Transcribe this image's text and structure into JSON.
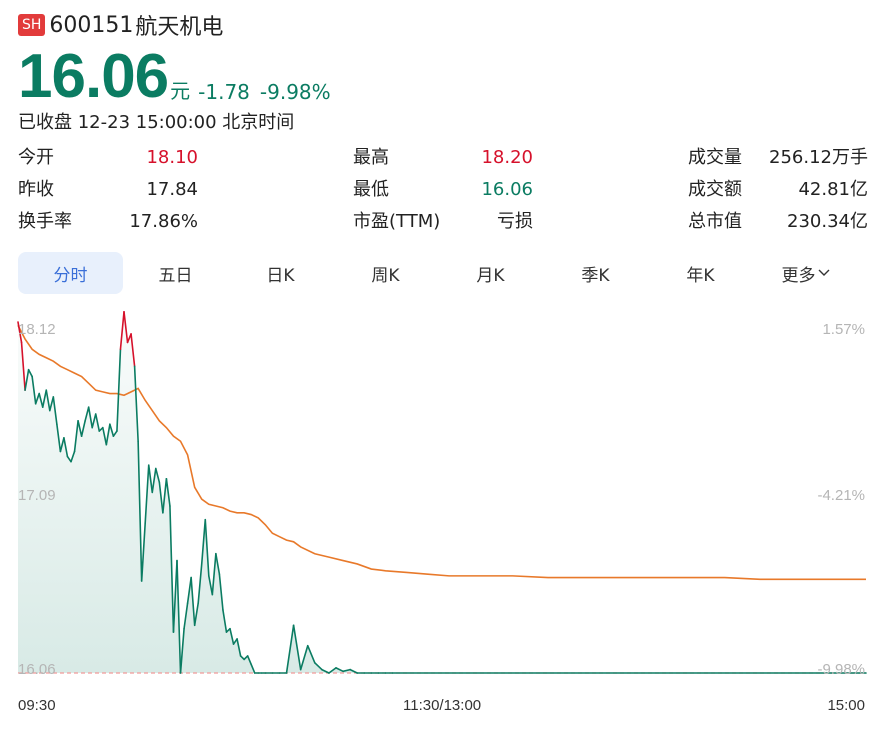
{
  "header": {
    "market_badge": "SH",
    "code": "600151",
    "name": "航天机电"
  },
  "quote": {
    "price": "16.06",
    "unit": "元",
    "change": "-1.78",
    "change_pct": "-9.98%",
    "status": "已收盘 12-23 15:00:00 北京时间"
  },
  "stats": {
    "open": {
      "label": "今开",
      "value": "18.10"
    },
    "prev_close": {
      "label": "昨收",
      "value": "17.84"
    },
    "turnover": {
      "label": "换手率",
      "value": "17.86%"
    },
    "high": {
      "label": "最高",
      "value": "18.20"
    },
    "low": {
      "label": "最低",
      "value": "16.06"
    },
    "pe": {
      "label": "市盈(TTM)",
      "value": "亏损"
    },
    "volume": {
      "label": "成交量",
      "value": "256.12万手"
    },
    "amount": {
      "label": "成交额",
      "value": "42.81亿"
    },
    "market_cap": {
      "label": "总市值",
      "value": "230.34亿"
    }
  },
  "tabs": [
    {
      "label": "分时",
      "active": true
    },
    {
      "label": "五日"
    },
    {
      "label": "日K"
    },
    {
      "label": "周K"
    },
    {
      "label": "月K"
    },
    {
      "label": "季K"
    },
    {
      "label": "年K"
    },
    {
      "label": "更多"
    }
  ],
  "colors": {
    "price_line": "#0b7c62",
    "price_line_up": "#d6112b",
    "avg_line": "#e8792a",
    "fill": "#0b7c62",
    "limit_line": "#f19a9a"
  },
  "chart_data": {
    "type": "line",
    "y_left_ticks": [
      "18.12",
      "17.09",
      "16.06"
    ],
    "y_right_ticks": [
      "1.57%",
      "-4.21%",
      "-9.98%"
    ],
    "x_ticks": [
      "09:30",
      "11:30/13:00",
      "15:00"
    ],
    "ylim": [
      16.06,
      18.12
    ],
    "xlim": [
      0,
      240
    ],
    "prev_close": 17.84,
    "series": [
      {
        "key": "price",
        "x": [
          0,
          1,
          2,
          3,
          4,
          5,
          6,
          7,
          8,
          9,
          10,
          11,
          12,
          13,
          14,
          15,
          16,
          17,
          18,
          19,
          20,
          21,
          22,
          23,
          24,
          25,
          26,
          27,
          28,
          29,
          30,
          31,
          32,
          33,
          34,
          35,
          36,
          37,
          38,
          39,
          40,
          41,
          42,
          43,
          44,
          45,
          46,
          47,
          48,
          49,
          50,
          51,
          52,
          53,
          54,
          55,
          56,
          57,
          58,
          59,
          60,
          61,
          62,
          63,
          64,
          65,
          66,
          67,
          68,
          69,
          70,
          72,
          74,
          76,
          78,
          80,
          82,
          84,
          86,
          88,
          90,
          92,
          94,
          96,
          98,
          100,
          102,
          104,
          106,
          240
        ],
        "y": [
          18.12,
          18.0,
          17.72,
          17.84,
          17.8,
          17.64,
          17.7,
          17.62,
          17.72,
          17.6,
          17.68,
          17.52,
          17.36,
          17.44,
          17.33,
          17.3,
          17.36,
          17.54,
          17.45,
          17.54,
          17.62,
          17.5,
          17.58,
          17.48,
          17.5,
          17.4,
          17.52,
          17.45,
          17.48,
          17.96,
          18.18,
          18.0,
          18.05,
          17.86,
          17.42,
          16.6,
          16.94,
          17.28,
          17.12,
          17.26,
          17.18,
          17.0,
          17.2,
          17.04,
          16.3,
          16.72,
          16.06,
          16.32,
          16.47,
          16.62,
          16.34,
          16.47,
          16.7,
          16.96,
          16.63,
          16.52,
          16.76,
          16.64,
          16.43,
          16.3,
          16.32,
          16.23,
          16.26,
          16.16,
          16.14,
          16.16,
          16.11,
          16.06,
          16.06,
          16.06,
          16.06,
          16.06,
          16.06,
          16.06,
          16.34,
          16.08,
          16.22,
          16.12,
          16.08,
          16.06,
          16.09,
          16.07,
          16.08,
          16.06,
          16.06,
          16.06,
          16.06,
          16.06,
          16.06,
          16.06
        ]
      },
      {
        "key": "average",
        "x": [
          0,
          2,
          4,
          6,
          8,
          10,
          12,
          14,
          16,
          18,
          20,
          22,
          24,
          26,
          28,
          30,
          32,
          34,
          36,
          38,
          40,
          42,
          44,
          46,
          48,
          50,
          52,
          54,
          56,
          58,
          60,
          62,
          64,
          66,
          68,
          70,
          72,
          74,
          76,
          78,
          80,
          84,
          88,
          92,
          96,
          100,
          104,
          110,
          116,
          122,
          130,
          140,
          150,
          160,
          170,
          180,
          190,
          200,
          210,
          240
        ],
        "y": [
          18.1,
          18.02,
          17.96,
          17.93,
          17.91,
          17.89,
          17.86,
          17.84,
          17.82,
          17.8,
          17.76,
          17.72,
          17.71,
          17.7,
          17.7,
          17.69,
          17.71,
          17.73,
          17.66,
          17.6,
          17.54,
          17.5,
          17.45,
          17.42,
          17.34,
          17.15,
          17.08,
          17.05,
          17.04,
          17.03,
          17.01,
          17.0,
          17.0,
          16.99,
          16.97,
          16.93,
          16.88,
          16.86,
          16.84,
          16.83,
          16.8,
          16.76,
          16.74,
          16.72,
          16.7,
          16.67,
          16.66,
          16.65,
          16.64,
          16.63,
          16.63,
          16.63,
          16.62,
          16.62,
          16.62,
          16.62,
          16.62,
          16.62,
          16.61,
          16.61
        ]
      }
    ]
  }
}
